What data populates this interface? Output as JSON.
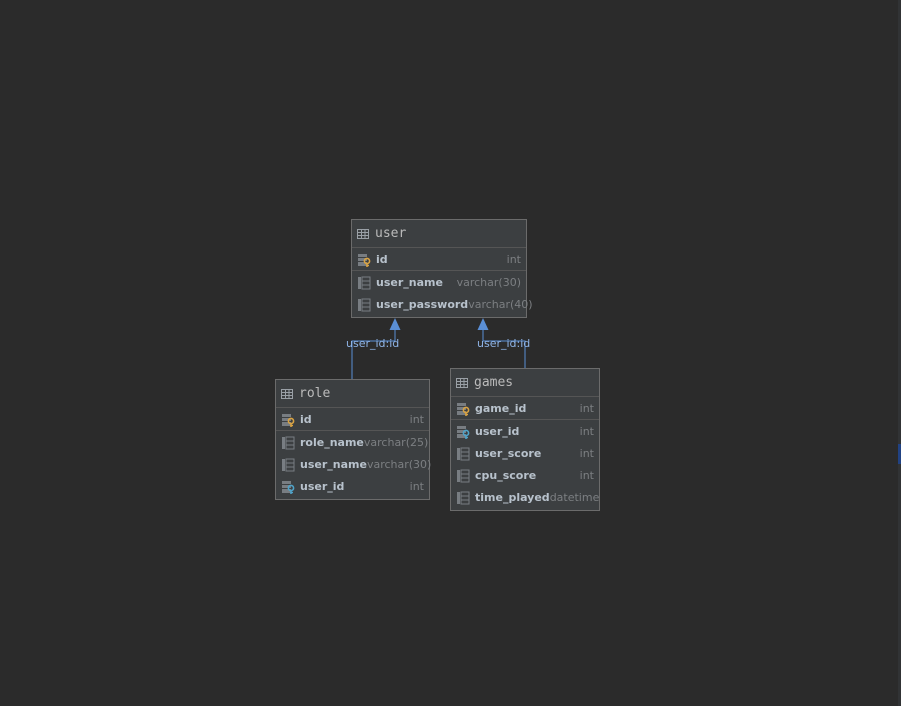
{
  "entities": {
    "user": {
      "name": "user",
      "columns": [
        {
          "name": "id",
          "type": "int",
          "kind": "primary-key"
        },
        {
          "name": "user_name",
          "type": "varchar(30)",
          "kind": "column"
        },
        {
          "name": "user_password",
          "type": "varchar(40)",
          "kind": "column"
        }
      ]
    },
    "role": {
      "name": "role",
      "columns": [
        {
          "name": "id",
          "type": "int",
          "kind": "primary-key"
        },
        {
          "name": "role_name",
          "type": "varchar(25)",
          "kind": "column"
        },
        {
          "name": "user_name",
          "type": "varchar(30)",
          "kind": "column"
        },
        {
          "name": "user_id",
          "type": "int",
          "kind": "foreign-key"
        }
      ]
    },
    "games": {
      "name": "games",
      "columns": [
        {
          "name": "game_id",
          "type": "int",
          "kind": "primary-key"
        },
        {
          "name": "user_id",
          "type": "int",
          "kind": "foreign-key"
        },
        {
          "name": "user_score",
          "type": "int",
          "kind": "column"
        },
        {
          "name": "cpu_score",
          "type": "int",
          "kind": "column"
        },
        {
          "name": "time_played",
          "type": "datetime",
          "kind": "column"
        }
      ]
    }
  },
  "relationships": [
    {
      "from": "role",
      "to": "user",
      "label": "user_id:id"
    },
    {
      "from": "games",
      "to": "user",
      "label": "user_id:id"
    }
  ],
  "colors": {
    "background": "#2b2b2b",
    "entity_fill": "#3c3f41",
    "connector": "#5a8fd6",
    "primary_key_icon": "#d9a343",
    "foreign_key_icon": "#4fa3c9"
  }
}
